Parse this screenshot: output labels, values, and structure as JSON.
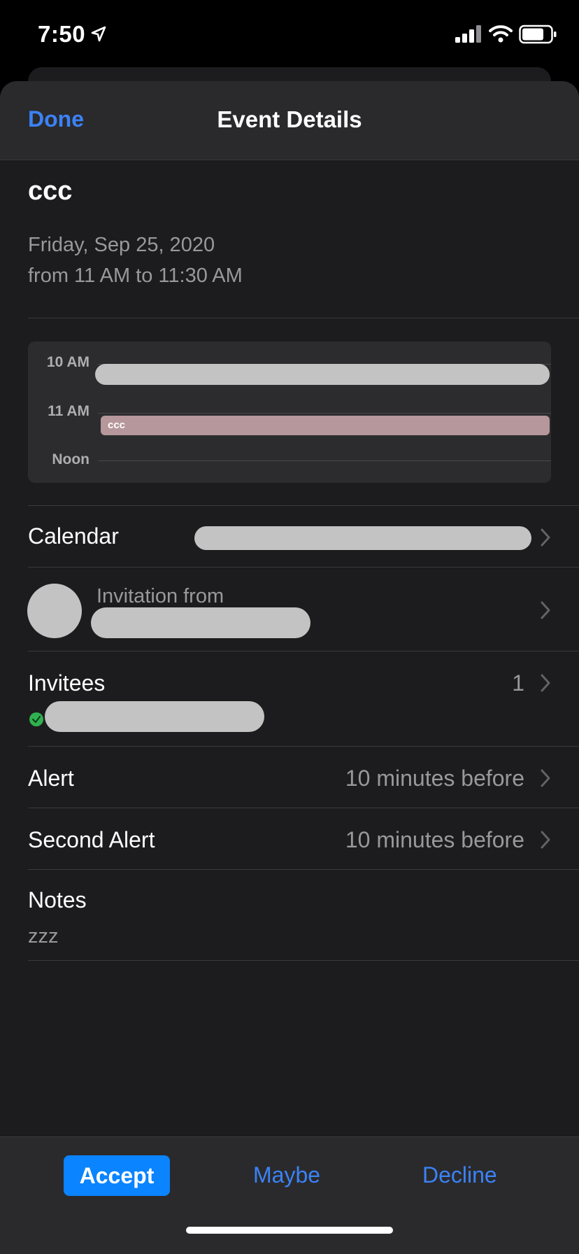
{
  "status_bar": {
    "time": "7:50"
  },
  "nav": {
    "done_label": "Done",
    "title": "Event Details"
  },
  "event": {
    "title": "ccc",
    "date": "Friday, Sep 25, 2020",
    "time_range": "from 11 AM to 11:30 AM"
  },
  "day_view": {
    "hours": [
      "10 AM",
      "11 AM",
      "Noon"
    ],
    "event_label": "ccc",
    "event_color": "#b6979b"
  },
  "calendar_row": {
    "label": "Calendar"
  },
  "invitation_row": {
    "label": "Invitation from"
  },
  "invitees_row": {
    "label": "Invitees",
    "count": "1"
  },
  "alert_row": {
    "label": "Alert",
    "value": "10 minutes before"
  },
  "second_alert_row": {
    "label": "Second Alert",
    "value": "10 minutes before"
  },
  "notes": {
    "label": "Notes",
    "value": "zzz"
  },
  "actions": {
    "accept": "Accept",
    "maybe": "Maybe",
    "decline": "Decline"
  },
  "colors": {
    "accent": "#3b82f6",
    "accept_bg": "#0a84ff",
    "sheet_bg": "#1c1c1e"
  }
}
